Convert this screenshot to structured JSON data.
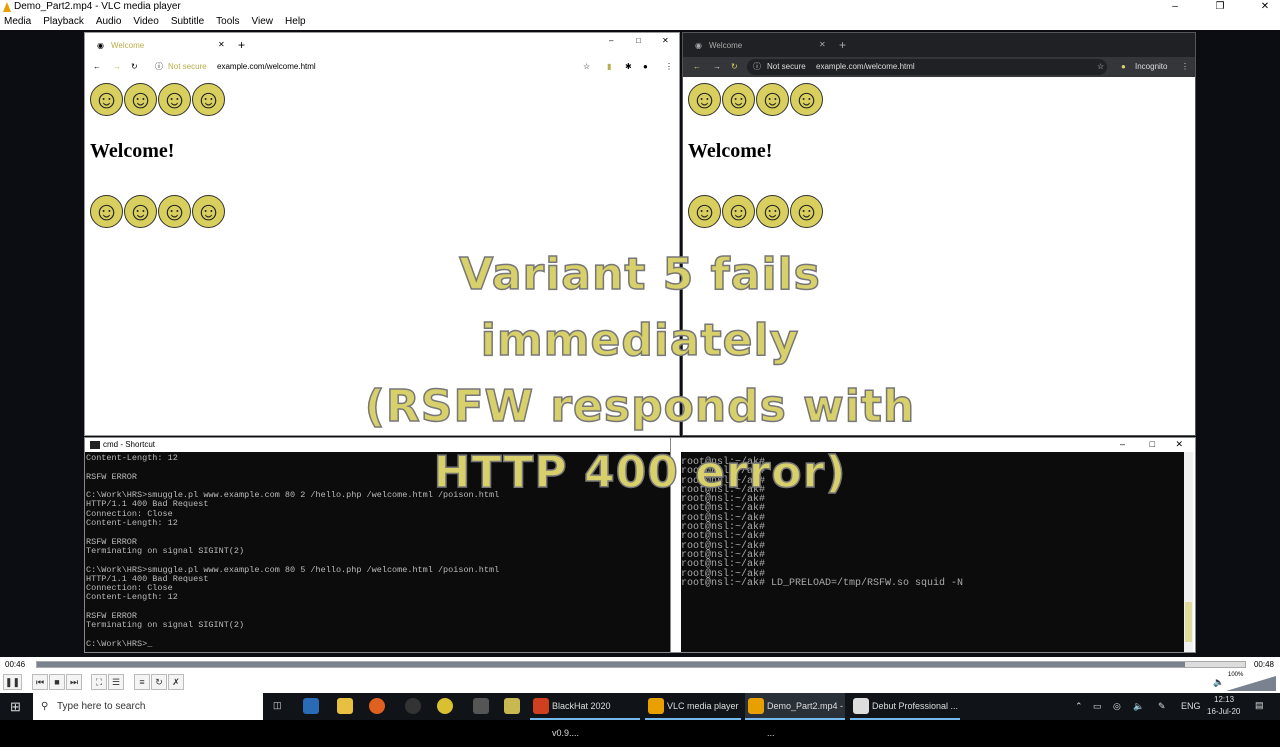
{
  "vlc": {
    "title": "Demo_Part2.mp4 - VLC media player",
    "menu": [
      "Media",
      "Playback",
      "Audio",
      "Video",
      "Subtitle",
      "Tools",
      "View",
      "Help"
    ],
    "time_elapsed": "00:46",
    "time_total": "00:48",
    "progress": 0.95,
    "volume": "100%",
    "volume_level": 1.0
  },
  "left_browser": {
    "tab_title": "Welcome",
    "security": "Not secure",
    "url": "example.com/welcome.html",
    "heading": "Welcome!"
  },
  "right_browser": {
    "tab_title": "Welcome",
    "security": "Not secure",
    "url": "example.com/welcome.html",
    "profile": "Incognito",
    "heading": "Welcome!"
  },
  "cmd": {
    "title": "cmd - Shortcut",
    "lines": [
      "Content-Length: 12",
      "",
      "RSFW ERROR",
      "",
      "C:\\Work\\HRS>smuggle.pl www.example.com 80 2 /hello.php /welcome.html /poison.html",
      "HTTP/1.1 400 Bad Request",
      "Connection: Close",
      "Content-Length: 12",
      "",
      "RSFW ERROR",
      "Terminating on signal SIGINT(2)",
      "",
      "C:\\Work\\HRS>smuggle.pl www.example.com 80 5 /hello.php /welcome.html /poison.html",
      "HTTP/1.1 400 Bad Request",
      "Connection: Close",
      "Content-Length: 12",
      "",
      "RSFW ERROR",
      "Terminating on signal SIGINT(2)",
      "",
      "C:\\Work\\HRS>_"
    ]
  },
  "terminal": {
    "lines": [
      "root@nsl:~/ak#",
      "root@nsl:~/ak#",
      "root@nsl:~/ak#",
      "root@nsl:~/ak#",
      "root@nsl:~/ak#",
      "root@nsl:~/ak#",
      "root@nsl:~/ak#",
      "root@nsl:~/ak#",
      "root@nsl:~/ak#",
      "root@nsl:~/ak#",
      "root@nsl:~/ak#",
      "root@nsl:~/ak#",
      "root@nsl:~/ak#",
      "root@nsl:~/ak# LD_PRELOAD=/tmp/RSFW.so squid -N"
    ]
  },
  "overlay": {
    "lines": [
      "Variant 5 fails",
      "immediately",
      "(RSFW responds with",
      "HTTP 400 error)"
    ]
  },
  "taskbar": {
    "search_placeholder": "Type here to search",
    "apps": [
      "BlackHat 2020 v0.9....",
      "VLC media player",
      "Demo_Part2.mp4 - ...",
      "Debut Professional ..."
    ],
    "lang": "ENG",
    "time": "12:13",
    "date": "16-Jul-20"
  }
}
